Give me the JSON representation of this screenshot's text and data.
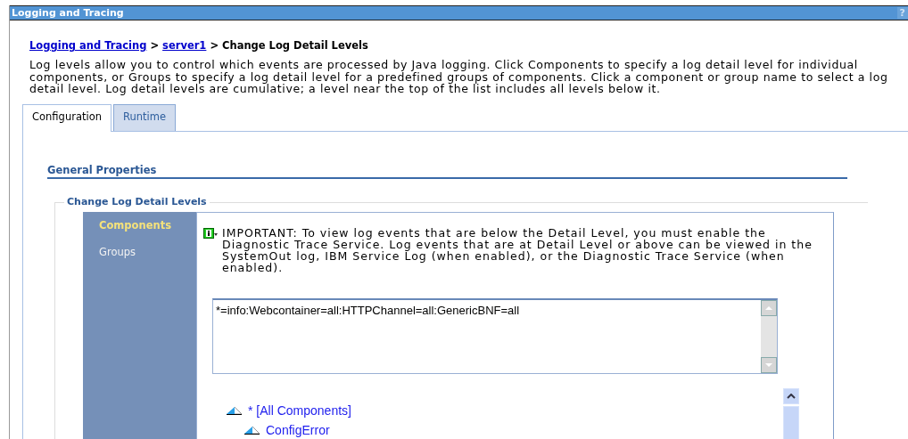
{
  "window": {
    "title": "Logging and Tracing",
    "help": "?"
  },
  "breadcrumb": {
    "links": [
      "Logging and Tracing",
      "server1"
    ],
    "separator": ">",
    "current": "Change Log Detail Levels"
  },
  "description": "Log levels allow you to control which events are processed by Java logging. Click Components to specify a log detail level for individual components, or Groups to specify a log detail level for a predefined groups of components. Click a component or group name to select a log detail level. Log detail levels are cumulative; a level near the top of the list includes all levels below it.",
  "tabs": [
    {
      "label": "Configuration",
      "selected": true
    },
    {
      "label": "Runtime",
      "selected": false
    }
  ],
  "section_title": "General Properties",
  "fieldset_title": "Change Log Detail Levels",
  "sidebar": {
    "items": [
      {
        "label": "Components",
        "selected": true
      },
      {
        "label": "Groups",
        "selected": false
      }
    ]
  },
  "notice": "IMPORTANT: To view log events that are below the Detail Level, you must enable the Diagnostic Trace Service. Log events that are at Detail Level or above can be viewed in the SystemOut log, IBM Service Log (when enabled), or the Diagnostic Trace Service (when enabled).",
  "trace_spec": "*=info:Webcontainer=all:HTTPChannel=all:GenericBNF=all",
  "tree": [
    {
      "label": "* [All Components]",
      "children": [
        {
          "label": "ConfigError"
        }
      ]
    }
  ]
}
